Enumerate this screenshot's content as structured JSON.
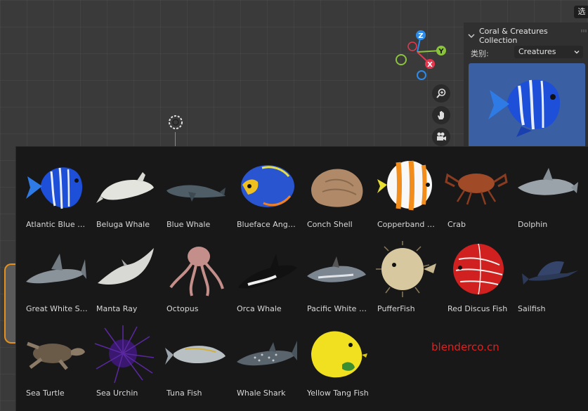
{
  "top_button": {
    "label": "选"
  },
  "gizmo": {
    "axes": {
      "z": "Z",
      "y": "Y",
      "x": "X"
    }
  },
  "panel": {
    "title": "Coral & Creatures Collection",
    "category_label": "类别:",
    "category_value": "Creatures",
    "preview_name": "Atlantic Blue Tang"
  },
  "assets": [
    {
      "name": "Atlantic Blue Ta...",
      "icon": "blue-tang-fish-icon"
    },
    {
      "name": "Beluga Whale",
      "icon": "beluga-whale-icon"
    },
    {
      "name": "Blue Whale",
      "icon": "blue-whale-icon"
    },
    {
      "name": "Blueface Angelfi...",
      "icon": "angelfish-icon"
    },
    {
      "name": "Conch Shell",
      "icon": "conch-shell-icon"
    },
    {
      "name": "Copperband But...",
      "icon": "butterflyfish-icon"
    },
    {
      "name": "Crab",
      "icon": "crab-icon"
    },
    {
      "name": "Dolphin",
      "icon": "dolphin-icon"
    },
    {
      "name": "Great White Sh...",
      "icon": "shark-icon"
    },
    {
      "name": "Manta Ray",
      "icon": "manta-ray-icon"
    },
    {
      "name": "Octopus",
      "icon": "octopus-icon"
    },
    {
      "name": "Orca Whale",
      "icon": "orca-icon"
    },
    {
      "name": "Pacific White Si...",
      "icon": "white-sided-dolphin-icon"
    },
    {
      "name": "PufferFish",
      "icon": "pufferfish-icon"
    },
    {
      "name": "Red Discus Fish",
      "icon": "discus-fish-icon"
    },
    {
      "name": "Sailfish",
      "icon": "sailfish-icon"
    },
    {
      "name": "Sea Turtle",
      "icon": "sea-turtle-icon"
    },
    {
      "name": "Sea Urchin",
      "icon": "sea-urchin-icon"
    },
    {
      "name": "Tuna Fish",
      "icon": "tuna-icon"
    },
    {
      "name": "Whale Shark",
      "icon": "whale-shark-icon"
    },
    {
      "name": "Yellow Tang Fish",
      "icon": "yellow-tang-icon"
    }
  ],
  "watermark": "blenderco.cn",
  "colors": {
    "axis_x": "#e8364f",
    "axis_y": "#8bc33c",
    "axis_z": "#2d8ceb",
    "watermark": "#e02020"
  }
}
